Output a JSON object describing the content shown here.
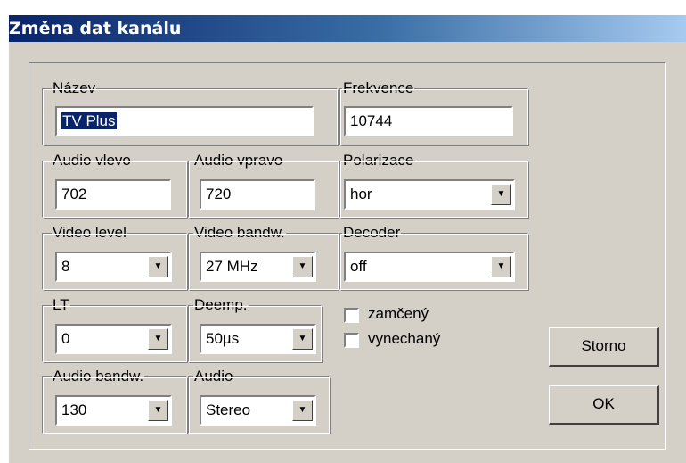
{
  "window": {
    "title": "Změna dat kanálu"
  },
  "fields": {
    "nazev": {
      "label": "Název",
      "value": "TV Plus"
    },
    "frekvence": {
      "label": "Frekvence",
      "value": "10744"
    },
    "audio_vlevo": {
      "label": "Audio vlevo",
      "value": "702"
    },
    "audio_vpravo": {
      "label": "Audio vpravo",
      "value": "720"
    },
    "polarizace": {
      "label": "Polarizace",
      "value": "hor"
    },
    "video_level": {
      "label": "Video level",
      "value": "8"
    },
    "video_bandw": {
      "label": "Video bandw.",
      "value": "27 MHz"
    },
    "decoder": {
      "label": "Decoder",
      "value": "off"
    },
    "lt": {
      "label": "LT",
      "value": "0"
    },
    "deemp": {
      "label": "Deemp.",
      "value": "50µs"
    },
    "audio_bandw": {
      "label": "Audio bandw.",
      "value": "130"
    },
    "audio": {
      "label": "Audio",
      "value": "Stereo"
    }
  },
  "checkboxes": {
    "zamceny": {
      "label": "zamčený",
      "checked": false
    },
    "vynechany": {
      "label": "vynechaný",
      "checked": false
    }
  },
  "buttons": {
    "storno": "Storno",
    "ok": "OK"
  },
  "icons": {
    "dropdown": "chevron-down-icon"
  }
}
